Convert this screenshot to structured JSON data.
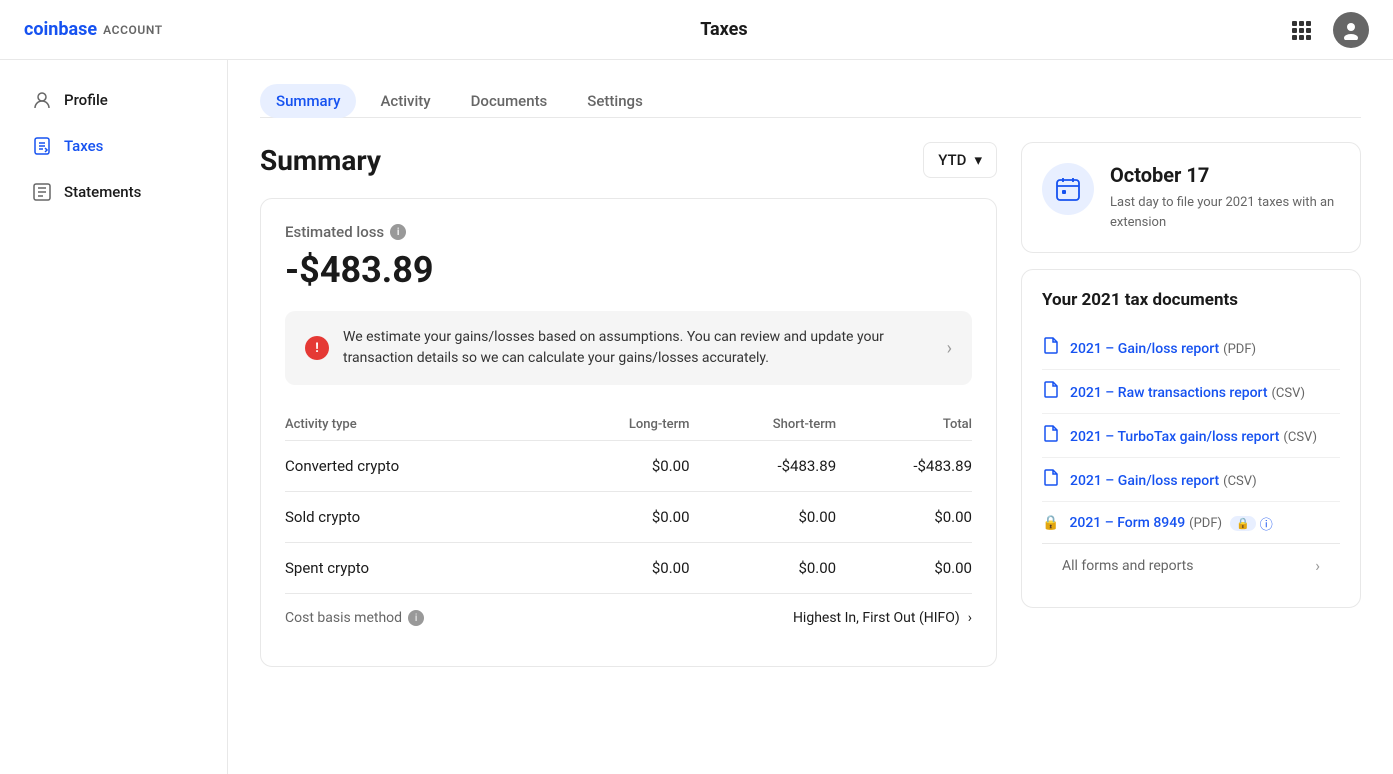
{
  "header": {
    "logo_brand": "coinbase",
    "logo_account": "ACCOUNT",
    "title": "Taxes",
    "grid_icon": "⊞",
    "avatar_icon": "👤"
  },
  "sidebar": {
    "items": [
      {
        "id": "profile",
        "label": "Profile",
        "icon": "person"
      },
      {
        "id": "taxes",
        "label": "Taxes",
        "icon": "taxes",
        "active": true
      },
      {
        "id": "statements",
        "label": "Statements",
        "icon": "statements"
      }
    ]
  },
  "tabs": [
    {
      "id": "summary",
      "label": "Summary",
      "active": true
    },
    {
      "id": "activity",
      "label": "Activity",
      "active": false
    },
    {
      "id": "documents",
      "label": "Documents",
      "active": false
    },
    {
      "id": "settings",
      "label": "Settings",
      "active": false
    }
  ],
  "summary": {
    "page_title": "Summary",
    "ytd_label": "YTD",
    "estimated_loss_label": "Estimated loss",
    "loss_amount": "-$483.89",
    "alert_text": "We estimate your gains/losses based on assumptions. You can review and update your transaction details so we can calculate your gains/losses accurately.",
    "table": {
      "headers": [
        "Activity type",
        "Long-term",
        "Short-term",
        "Total"
      ],
      "rows": [
        {
          "type": "Converted crypto",
          "long_term": "$0.00",
          "short_term": "-$483.89",
          "total": "-$483.89"
        },
        {
          "type": "Sold crypto",
          "long_term": "$0.00",
          "short_term": "$0.00",
          "total": "$0.00"
        },
        {
          "type": "Spent crypto",
          "long_term": "$0.00",
          "short_term": "$0.00",
          "total": "$0.00"
        }
      ]
    },
    "cost_basis_label": "Cost basis method",
    "cost_basis_value": "Highest In, First Out (HIFO)"
  },
  "right_panel": {
    "date_card": {
      "date": "October 17",
      "description": "Last day to file your 2021 taxes with an extension"
    },
    "docs_card": {
      "title": "Your 2021 tax documents",
      "documents": [
        {
          "id": "gain-loss-pdf",
          "link_text": "2021 – Gain/loss report",
          "format": "(PDF)",
          "locked": false
        },
        {
          "id": "raw-transactions",
          "link_text": "2021 – Raw transactions report",
          "format": "(CSV)",
          "locked": false
        },
        {
          "id": "turbotax",
          "link_text": "2021 – TurboTax gain/loss report",
          "format": "(CSV)",
          "locked": false
        },
        {
          "id": "gain-loss-csv",
          "link_text": "2021 – Gain/loss report",
          "format": "(CSV)",
          "locked": false
        },
        {
          "id": "form-8949",
          "link_text": "2021 – Form 8949",
          "format": "(PDF)",
          "locked": true
        }
      ],
      "all_reports_label": "All forms and reports"
    }
  }
}
